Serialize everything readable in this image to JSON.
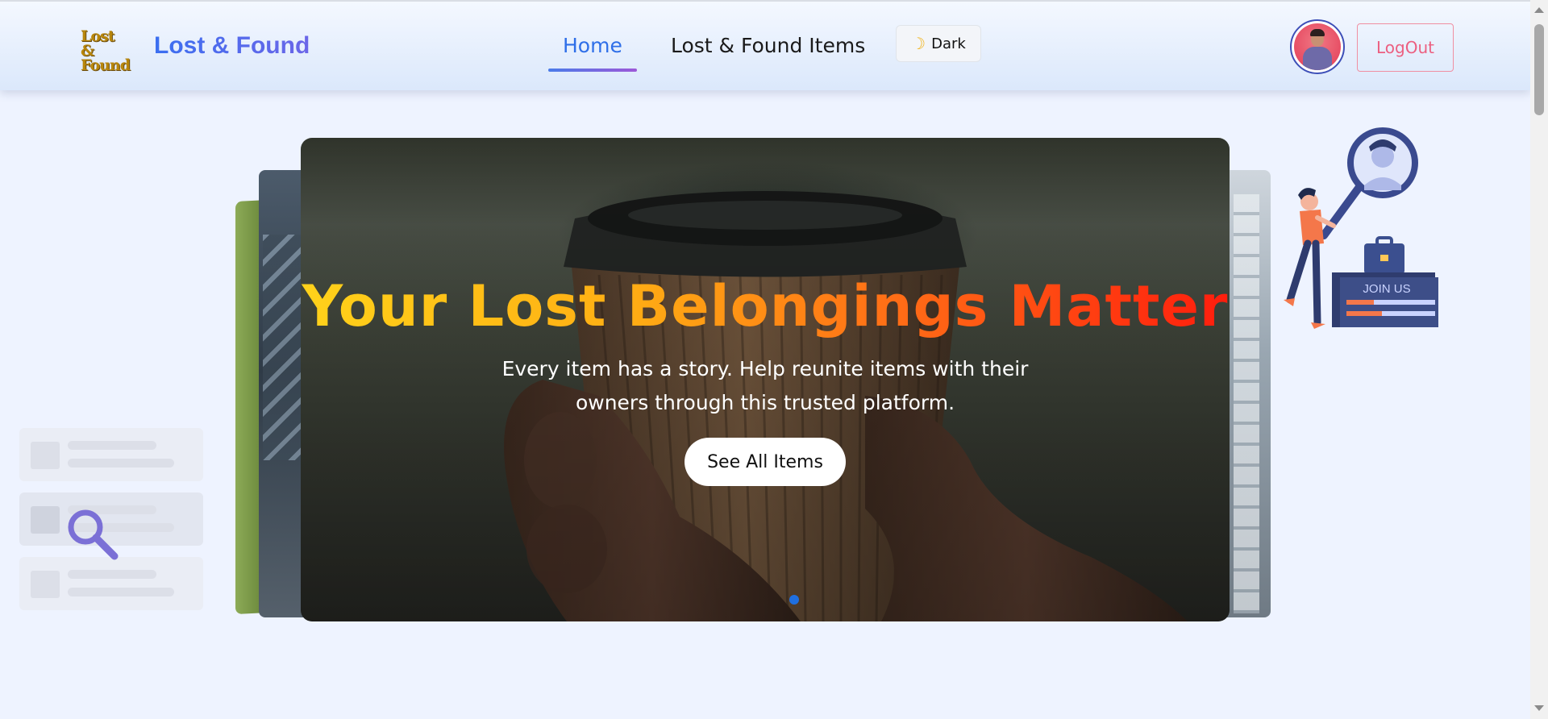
{
  "navbar": {
    "logo_line1": "Lost &",
    "logo_line2": "Found",
    "brand_name": "Lost & Found",
    "links": [
      {
        "label": "Home",
        "active": true
      },
      {
        "label": "Lost & Found Items",
        "active": false
      }
    ],
    "theme_toggle": {
      "icon": "moon-icon",
      "label": "Dark"
    },
    "logout_label": "LogOut"
  },
  "hero": {
    "title": "Your Lost Belongings Matter",
    "subtitle": "Every item has a story. Help reunite items with their owners through this trusted platform.",
    "cta_label": "See All Items",
    "active_slide": 1
  },
  "illustration": {
    "sign_text": "JOIN US"
  },
  "colors": {
    "brand": "#4a6fe0",
    "active_link": "#2f6fe8",
    "logout": "#ec5f80",
    "title_gradient_start": "#ffd21a",
    "title_gradient_end": "#ff1d0d",
    "dot": "#1f6fe0",
    "page_bg": "#eef3ff"
  }
}
